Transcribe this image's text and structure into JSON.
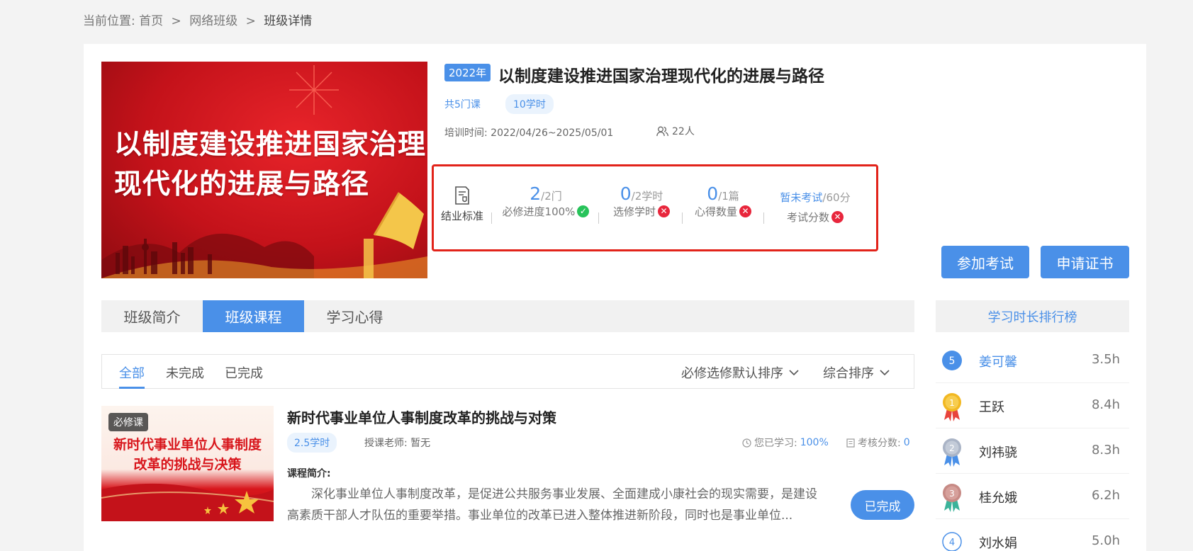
{
  "breadcrumb": {
    "prefix": "当前位置:",
    "home": "首页",
    "level2": "网络班级",
    "current": "班级详情",
    "sep": ">"
  },
  "cover": {
    "line1": "以制度建设推进国家治理",
    "line2": "现代化的进展与路径"
  },
  "class": {
    "year": "2022年",
    "title": "以制度建设推进国家治理现代化的进展与路径",
    "courses": "共5门课",
    "hours": "10学时",
    "train_time": "培训时间: 2022/04/26~2025/05/01",
    "people": "22人"
  },
  "standard": {
    "label": "结业标准",
    "items": [
      {
        "num": "2",
        "den": "/2门",
        "label": "必修进度100%",
        "status": "ok"
      },
      {
        "num": "0",
        "den": "/2学时",
        "label": "选修学时",
        "status": "no"
      },
      {
        "num": "0",
        "den": "/1篇",
        "label": "心得数量",
        "status": "no"
      },
      {
        "num": "暂未考试",
        "den": "/60分",
        "label": "考试分数",
        "status": "no"
      }
    ]
  },
  "buttons": {
    "exam": "参加考试",
    "cert": "申请证书"
  },
  "tabs": [
    "班级简介",
    "班级课程",
    "学习心得"
  ],
  "active_tab": "班级课程",
  "filters": [
    "全部",
    "未完成",
    "已完成"
  ],
  "sorts": [
    "必修选修默认排序",
    "综合排序"
  ],
  "course": {
    "badge": "必修课",
    "img_line1": "新时代事业单位人事制度",
    "img_line2": "改革的挑战与决策",
    "title": "新时代事业单位人事制度改革的挑战与对策",
    "hours": "2.5学时",
    "teacher": "授课老师: 暂无",
    "progress_label": "您已学习:",
    "progress_value": "100%",
    "progress": 1.0,
    "score_label": "考核分数:",
    "score_value": "0",
    "intro_label": "课程简介:",
    "intro": "深化事业单位人事制度改革，是促进公共服务事业发展、全面建成小康社会的现实需要，是建设高素质干部人才队伍的重要举措。事业单位的改革已进入整体推进新阶段，同时也是事业单位...",
    "status_button": "已完成"
  },
  "ranking": {
    "title": "学习时长排行榜",
    "rows": [
      {
        "rank": "5",
        "name": "姜可馨",
        "hours": "3.5h",
        "me": true
      },
      {
        "rank": "1",
        "name": "王跃",
        "hours": "8.4h"
      },
      {
        "rank": "2",
        "name": "刘祎骁",
        "hours": "8.3h"
      },
      {
        "rank": "3",
        "name": "桂允娥",
        "hours": "6.2h"
      },
      {
        "rank": "4",
        "name": "刘水娟",
        "hours": "5.0h"
      }
    ]
  },
  "colors": {
    "accent": "#4a90e8",
    "highlight_border": "#e2231a",
    "ok": "#27c35a",
    "fail": "#e8263c",
    "gold": "#f2b822",
    "silver": "#aab4c6",
    "bronze": "#c78a85"
  }
}
